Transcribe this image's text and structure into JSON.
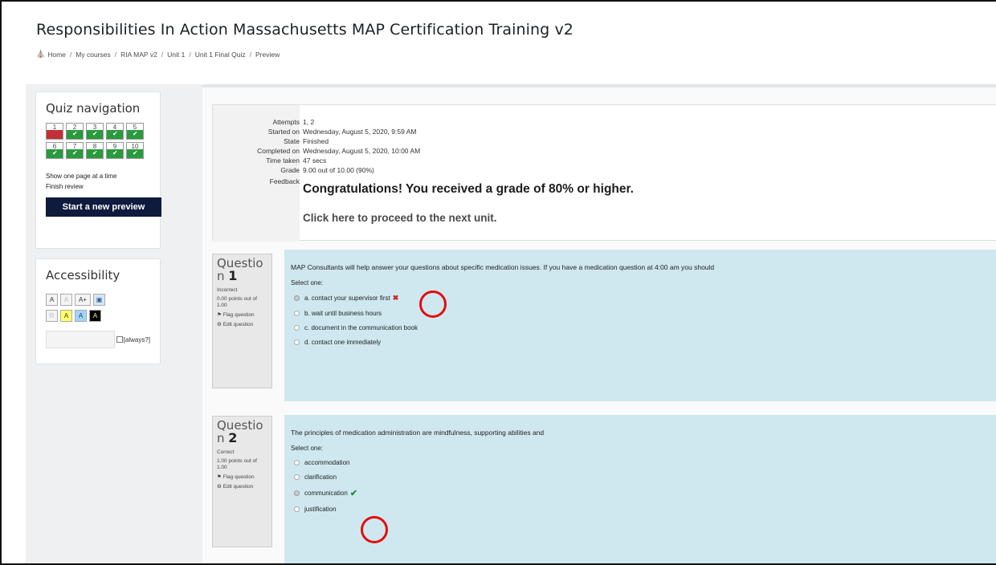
{
  "page": {
    "title": "Responsibilities In Action Massachusetts MAP Certification Training v2",
    "breadcrumb": [
      "Home",
      "My courses",
      "RIA MAP v2",
      "Unit 1",
      "Unit 1 Final Quiz",
      "Preview"
    ]
  },
  "quiz_nav": {
    "title": "Quiz navigation",
    "questions": [
      {
        "num": "1",
        "status": "incorrect"
      },
      {
        "num": "2",
        "status": "correct"
      },
      {
        "num": "3",
        "status": "correct"
      },
      {
        "num": "4",
        "status": "correct"
      },
      {
        "num": "5",
        "status": "correct"
      },
      {
        "num": "6",
        "status": "correct"
      },
      {
        "num": "7",
        "status": "correct"
      },
      {
        "num": "8",
        "status": "correct"
      },
      {
        "num": "9",
        "status": "correct"
      },
      {
        "num": "10",
        "status": "correct"
      }
    ],
    "show_one_page": "Show one page at a time",
    "finish_review": "Finish review",
    "start_preview": "Start a new preview"
  },
  "accessibility": {
    "title": "Accessibility",
    "font_buttons": [
      "A",
      "A",
      "A+"
    ],
    "colour_buttons": [
      "R",
      "A",
      "A",
      "A"
    ],
    "always_label": "[always?]"
  },
  "summary": {
    "rows": [
      {
        "label": "Attempts",
        "value": "1, 2"
      },
      {
        "label": "Started on",
        "value": "Wednesday, August 5, 2020, 9:59 AM"
      },
      {
        "label": "State",
        "value": "Finished"
      },
      {
        "label": "Completed on",
        "value": "Wednesday, August 5, 2020, 10:00 AM"
      },
      {
        "label": "Time taken",
        "value": "47 secs"
      },
      {
        "label": "Grade",
        "value": "9.00 out of 10.00 (90%)"
      }
    ],
    "feedback_label": "Feedback",
    "feedback_text": "Congratulations! You received a grade of 80% or higher.",
    "feedback_link": "Click here to proceed to the next unit."
  },
  "questions": [
    {
      "word": "Questio",
      "n_prefix": "n",
      "number": "1",
      "state": "Incorrect",
      "points": "0.00 points out of 1.00",
      "flag": "Flag question",
      "edit": "Edit question",
      "text": "MAP Consultants will help answer your questions about specific medication issues. If you have a medication question at 4:00 am you should",
      "select_label": "Select one:",
      "answers": [
        {
          "text": "a. contact your supervisor first",
          "checked": true,
          "mark": "✖"
        },
        {
          "text": "b. wait until business hours",
          "checked": false,
          "mark": ""
        },
        {
          "text": "c. document in the communication book",
          "checked": false,
          "mark": ""
        },
        {
          "text": "d. contact one immediately",
          "checked": false,
          "mark": ""
        }
      ]
    },
    {
      "word": "Questio",
      "n_prefix": "n",
      "number": "2",
      "state": "Correct",
      "points": "1.00 points out of 1.00",
      "flag": "Flag question",
      "edit": "Edit question",
      "text": "The principles of medication administration are mindfulness, supporting abilities and",
      "select_label": "Select one:",
      "answers": [
        {
          "text": "accommodation",
          "checked": false,
          "mark": ""
        },
        {
          "text": "clarification",
          "checked": false,
          "mark": ""
        },
        {
          "text": "communication",
          "checked": true,
          "mark": "✔"
        },
        {
          "text": "justification",
          "checked": false,
          "mark": ""
        }
      ]
    }
  ],
  "colors": {
    "correct": "#2a9a3e",
    "incorrect": "#c22f35",
    "annotation": "#e40d0d",
    "question_bg": "#cfe8f0",
    "primary_button": "#0f1b3d"
  }
}
